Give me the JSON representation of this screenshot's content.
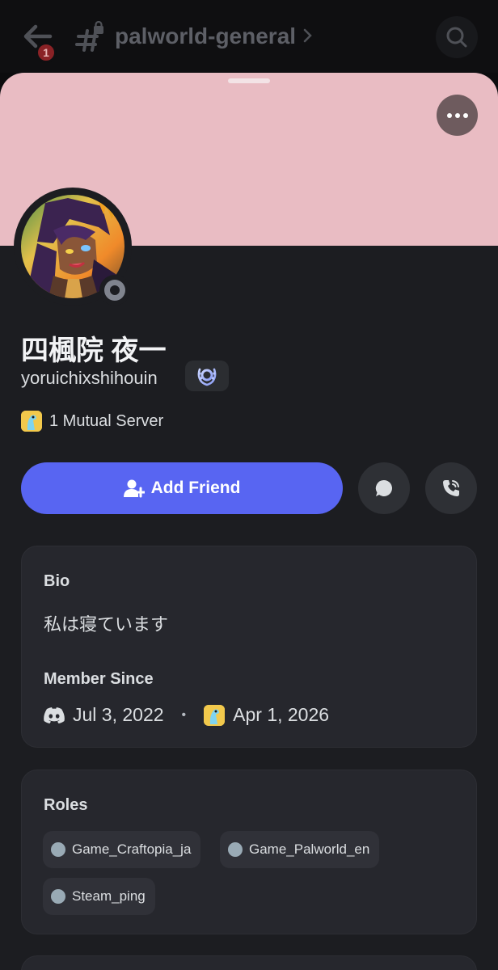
{
  "header": {
    "unread_count": "1",
    "channel_name": "palworld-general"
  },
  "profile": {
    "display_name": "四楓院 夜一",
    "username": "yoruichixshihouin",
    "mutual_servers": "1 Mutual Server",
    "status": "offline",
    "banner_color": "#e9bcc3"
  },
  "actions": {
    "add_friend_label": "Add Friend"
  },
  "bio": {
    "heading": "Bio",
    "text": "私は寝ています"
  },
  "member_since": {
    "heading": "Member Since",
    "discord_date": "Jul 3, 2022",
    "separator": "•",
    "server_date": "Apr 1, 2026"
  },
  "roles": {
    "heading": "Roles",
    "items": [
      {
        "label": "Game_Craftopia_ja",
        "color": "#99aab5"
      },
      {
        "label": "Game_Palworld_en",
        "color": "#99aab5"
      },
      {
        "label": "Steam_ping",
        "color": "#99aab5"
      }
    ]
  },
  "colors": {
    "accent": "#5865f2",
    "background": "#1c1d21",
    "card": "#26272d"
  }
}
